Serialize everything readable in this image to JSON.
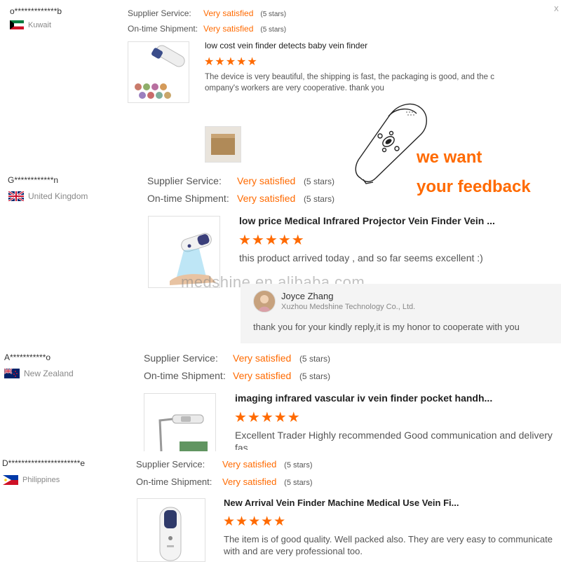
{
  "reviews": [
    {
      "buyer": "o*************b",
      "country": "Kuwait",
      "supplier_label": "Supplier Service:",
      "supplier_value": "Very satisfied",
      "supplier_stars": "(5 stars)",
      "shipment_label": "On-time Shipment:",
      "shipment_value": "Very satisfied",
      "shipment_stars": "(5 stars)",
      "product_title": "low cost vein finder detects baby vein finder",
      "rating": "★★★★★",
      "text": "The device is very beautiful, the shipping is fast, the packaging is good, and the c\nompany's workers are very cooperative. thank you"
    },
    {
      "buyer": "G************n",
      "country": "United Kingdom",
      "supplier_label": "Supplier Service:",
      "supplier_value": "Very satisfied",
      "supplier_stars": "(5 stars)",
      "shipment_label": "On-time Shipment:",
      "shipment_value": "Very satisfied",
      "shipment_stars": "(5 stars)",
      "product_title": "low price Medical Infrared Projector Vein Finder Vein ...",
      "rating": "★★★★★",
      "text": "this product arrived today , and so far seems excellent :)"
    },
    {
      "buyer": "A***********o",
      "country": "New Zealand",
      "supplier_label": "Supplier Service:",
      "supplier_value": "Very satisfied",
      "supplier_stars": "(5 stars)",
      "shipment_label": "On-time Shipment:",
      "shipment_value": "Very satisfied",
      "shipment_stars": "(5 stars)",
      "product_title": "imaging infrared vascular iv vein finder pocket handh...",
      "rating": "★★★★★",
      "text": "Excellent Trader Highly recommended Good communication and  delivery fas\ntime"
    },
    {
      "buyer": "D**********************e",
      "country": "Philippines",
      "supplier_label": "Supplier Service:",
      "supplier_value": "Very satisfied",
      "supplier_stars": "(5 stars)",
      "shipment_label": "On-time Shipment:",
      "shipment_value": "Very satisfied",
      "shipment_stars": "(5 stars)",
      "product_title": "New Arrival Vein Finder Machine Medical Use Vein Fi...",
      "rating": "★★★★★",
      "text": "The item is of good quality. Well packed also. They are very easy to communicate\nwith and are very professional too."
    }
  ],
  "reply": {
    "name": "Joyce Zhang",
    "company": "Xuzhou Medshine Technology Co., Ltd.",
    "text": "thank you for your kindly reply,it is my honor to cooperate with you"
  },
  "banner": {
    "line1": "we want",
    "line2": "your feedback"
  },
  "watermark": "medshine.en.alibaba.com",
  "corner_glyph": "X"
}
